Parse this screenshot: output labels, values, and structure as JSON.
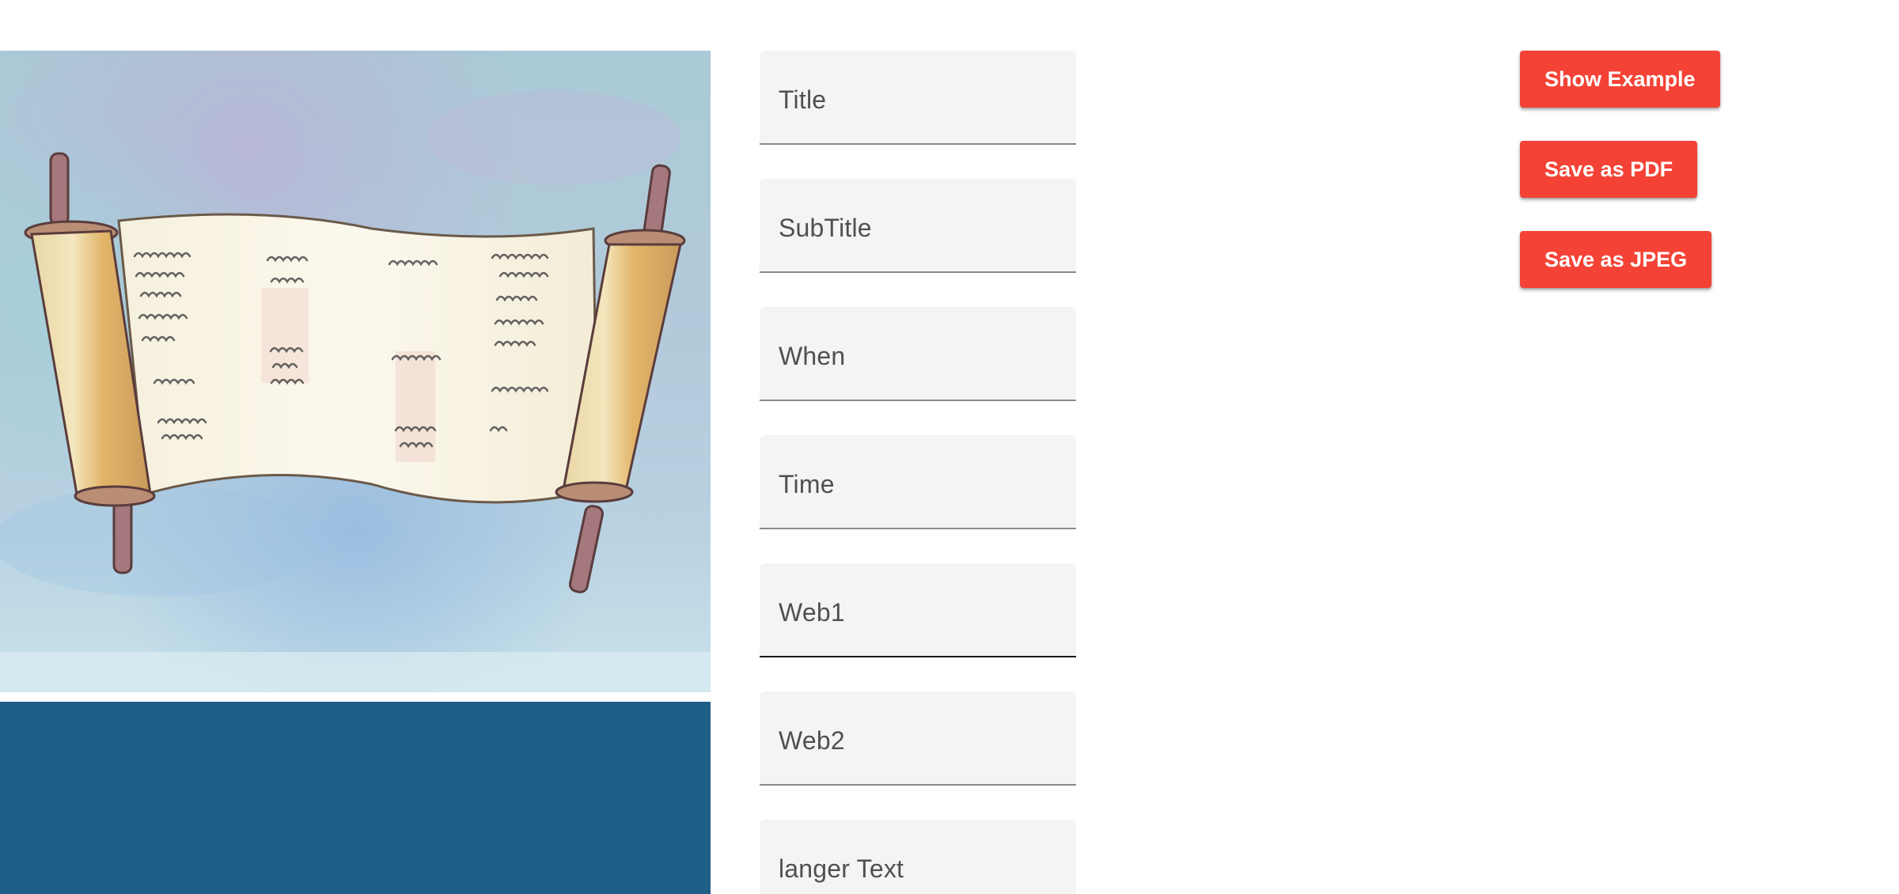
{
  "colors": {
    "accent_button": "#f44336",
    "preview_band": "#1f5e87",
    "field_background": "#f4f4f4",
    "field_underline": "#8a8a8a",
    "field_underline_active": "#1a1a1a"
  },
  "preview": {
    "image_subject": "watercolor torah scroll on blue background"
  },
  "form": {
    "fields": [
      {
        "label": "Title"
      },
      {
        "label": "SubTitle"
      },
      {
        "label": "When"
      },
      {
        "label": "Time"
      },
      {
        "label": "Web1"
      },
      {
        "label": "Web2"
      },
      {
        "label": "langer Text"
      }
    ]
  },
  "actions": {
    "show_example": "Show Example",
    "save_pdf": "Save as PDF",
    "save_jpeg": "Save as JPEG"
  }
}
